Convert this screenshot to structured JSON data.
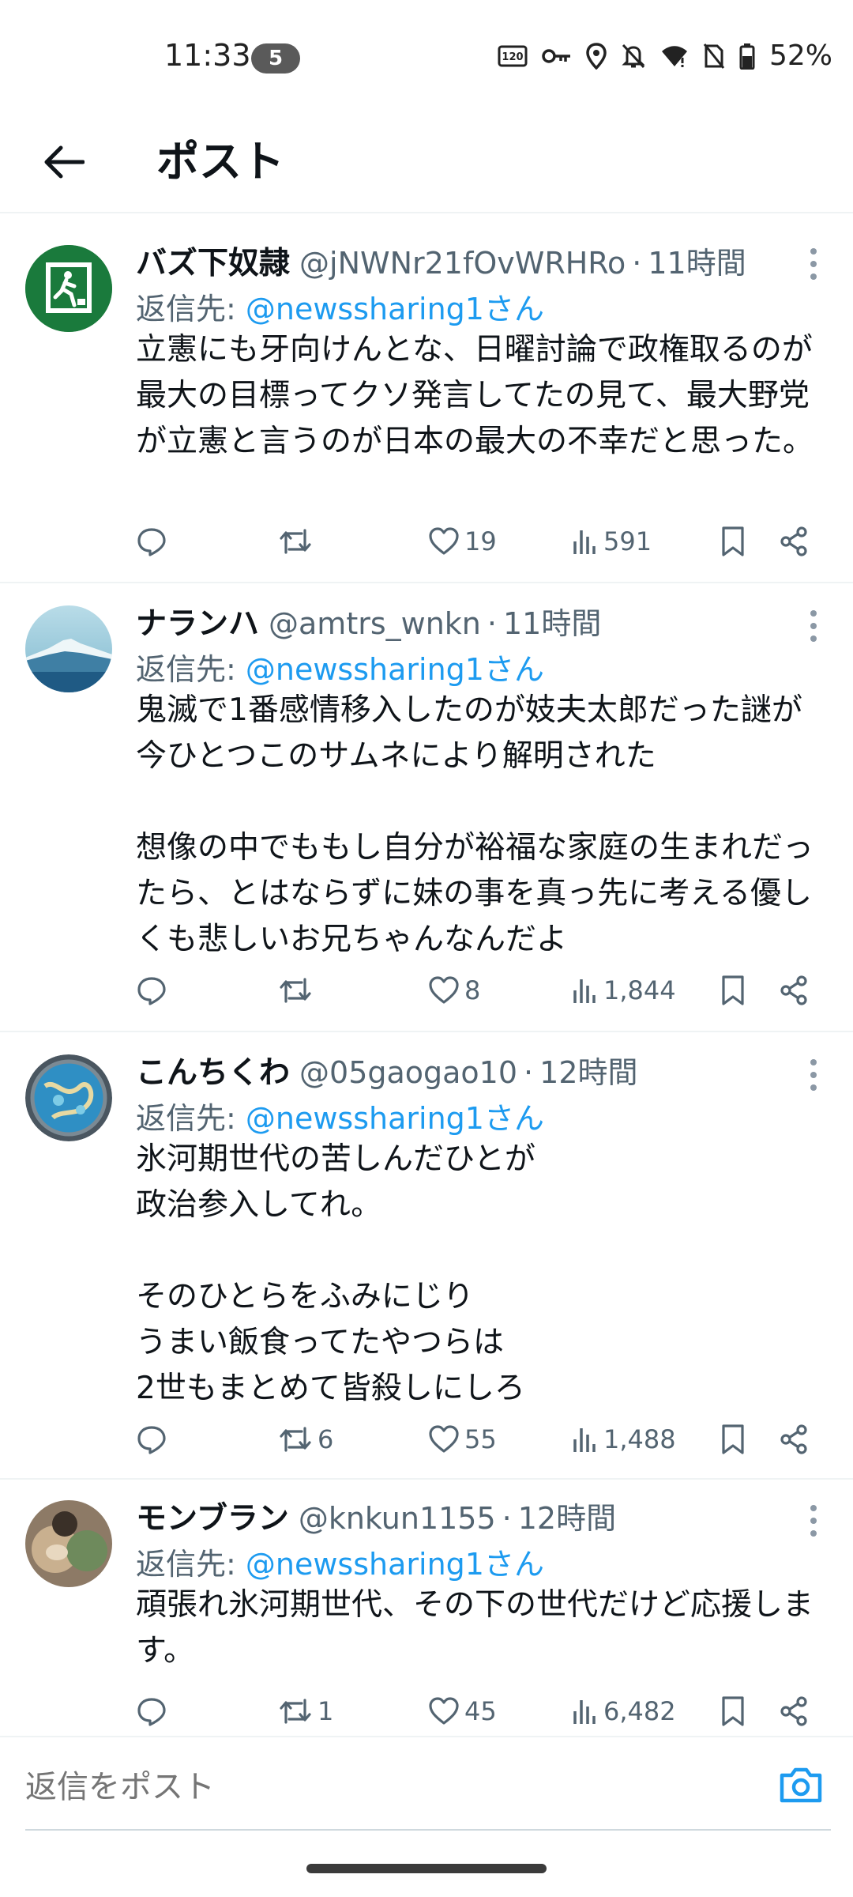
{
  "status_bar": {
    "time": "11:33",
    "notification_count": "5",
    "battery_percent": "52%"
  },
  "header": {
    "title": "ポスト"
  },
  "tweets": [
    {
      "name": "バズ下奴隷",
      "handle": "@jNWNr21fOvWRHRo",
      "dot": "·",
      "time": "11時間",
      "reply_prefix": "返信先: ",
      "reply_to": "@newssharing1さん",
      "body": "立憲にも牙向けんとな、日曜討論で政権取るのが最大の目標ってクソ発言してたの見て、最大野党が立憲と言うのが日本の最大の不幸だと思った。",
      "replies": "",
      "retweets": "",
      "likes": "19",
      "views": "591"
    },
    {
      "name": "ナランハ",
      "handle": "@amtrs_wnkn",
      "dot": "·",
      "time": "11時間",
      "reply_prefix": "返信先: ",
      "reply_to": "@newssharing1さん",
      "body": "鬼滅で1番感情移入したのが妓夫太郎だった謎が今ひとつこのサムネにより解明された\n\n想像の中でももし自分が裕福な家庭の生まれだったら、とはならずに妹の事を真っ先に考える優しくも悲しいお兄ちゃんなんだよ",
      "replies": "",
      "retweets": "",
      "likes": "8",
      "views": "1,844"
    },
    {
      "name": "こんちくわ",
      "handle": "@05gaogao10",
      "dot": "·",
      "time": "12時間",
      "reply_prefix": "返信先: ",
      "reply_to": "@newssharing1さん",
      "body": "氷河期世代の苦しんだひとが\n政治参入してれ。\n\nそのひとらをふみにじり\nうまい飯食ってたやつらは\n2世もまとめて皆殺しにしろ",
      "replies": "",
      "retweets": "6",
      "likes": "55",
      "views": "1,488"
    },
    {
      "name": "モンブラン",
      "handle": "@knkun1155",
      "dot": "·",
      "time": "12時間",
      "reply_prefix": "返信先: ",
      "reply_to": "@newssharing1さん",
      "body": "頑張れ氷河期世代、その下の世代だけど応援します。",
      "replies": "",
      "retweets": "1",
      "likes": "45",
      "views": "6,482"
    }
  ],
  "reply_bar": {
    "placeholder": "返信をポスト"
  },
  "colors": {
    "accent": "#1d9bf0",
    "secondary_text": "#536471",
    "primary_text": "#0f1419",
    "divider": "#eff3f4"
  }
}
